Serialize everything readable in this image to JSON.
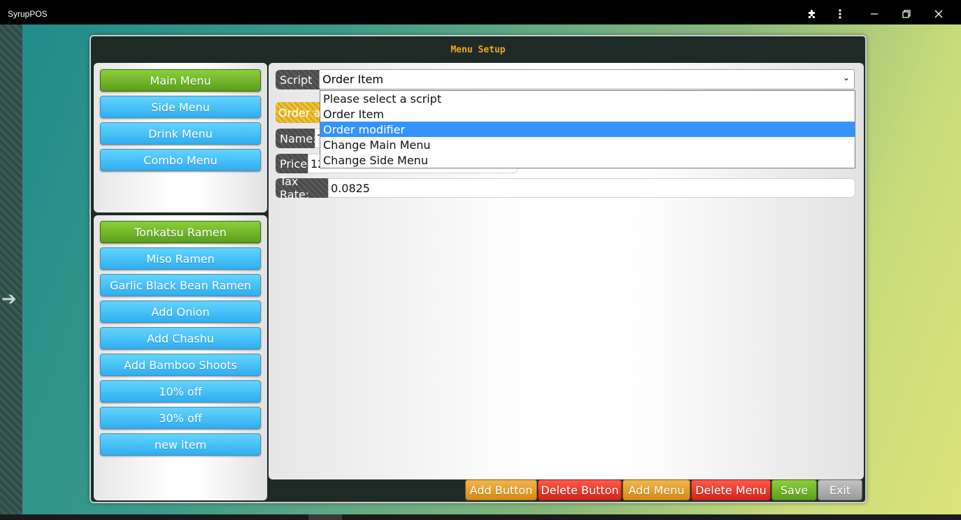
{
  "app": {
    "title": "SyrupPOS"
  },
  "window": {
    "title": "Menu Setup"
  },
  "menus": [
    {
      "label": "Main Menu",
      "active": true
    },
    {
      "label": "Side Menu",
      "active": false
    },
    {
      "label": "Drink Menu",
      "active": false
    },
    {
      "label": "Combo Menu",
      "active": false
    }
  ],
  "items": [
    {
      "label": "Tonkatsu Ramen",
      "active": true
    },
    {
      "label": "Miso Ramen",
      "active": false
    },
    {
      "label": "Garlic Black Bean Ramen",
      "active": false
    },
    {
      "label": "Add Onion",
      "active": false
    },
    {
      "label": "Add Chashu",
      "active": false
    },
    {
      "label": "Add Bamboo Shoots",
      "active": false
    },
    {
      "label": "10% off",
      "active": false
    },
    {
      "label": "30% off",
      "active": false
    },
    {
      "label": "new item",
      "active": false
    }
  ],
  "form": {
    "script_label": "Script",
    "script_value": "Order Item",
    "script_options": [
      "Please select a script",
      "Order Item",
      "Order modifier",
      "Change Main Menu",
      "Change Side Menu"
    ],
    "script_highlighted": "Order modifier",
    "order_badge": "Order a",
    "name_label": "Name:",
    "name_value": "T",
    "price_label": "Price:",
    "price_value": "12",
    "tax_label": "Tax Rate:",
    "tax_value": "0.0825"
  },
  "actions": {
    "add_button": "Add Button",
    "delete_button": "Delete Button",
    "add_menu": "Add Menu",
    "delete_menu": "Delete Menu",
    "save": "Save",
    "exit": "Exit"
  },
  "colors": {
    "active_green": "#6cb52a",
    "inactive_blue": "#42c0f7",
    "highlight_blue": "#3393ff",
    "title_orange": "#f2a623"
  }
}
